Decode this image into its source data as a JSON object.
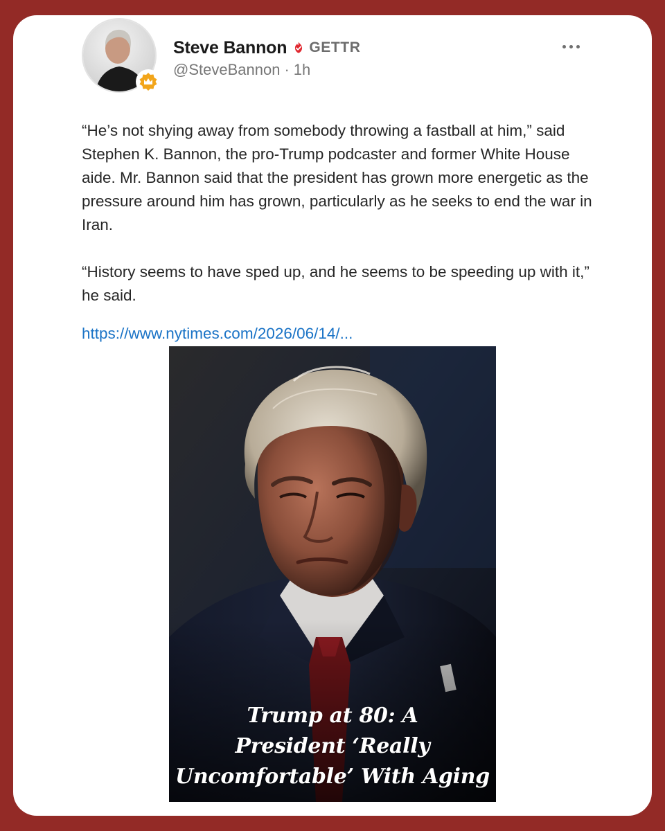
{
  "post": {
    "author": {
      "display_name": "Steve Bannon",
      "platform": "GETTR",
      "handle": "@SteveBannon",
      "separator": "·",
      "time_ago": "1h",
      "verified_icon": "verified-flame-icon",
      "badge_icon": "crown-icon"
    },
    "paragraphs": [
      "“He’s not shying away from somebody throwing a fastball at him,” said Stephen K. Bannon, the pro-Trump podcaster and former White House aide. Mr. Bannon said that the president has grown more energetic as the pressure around him has grown, particularly as he seeks to end the war in Iran.",
      "“History seems to have sped up, and he seems to be speeding up with it,” he said."
    ],
    "link_text": "https://www.nytimes.com/2026/06/14/...",
    "image": {
      "headline_lines": [
        "Trump at 80: A",
        "President ‘Really",
        "Uncomfortable’ With Aging"
      ]
    },
    "more_icon": "more-horizontal-icon"
  },
  "colors": {
    "frame": "#932a26",
    "card": "#ffffff",
    "link": "#1a73c6",
    "verified": "#e0272f",
    "badge": "#f2a51a"
  }
}
